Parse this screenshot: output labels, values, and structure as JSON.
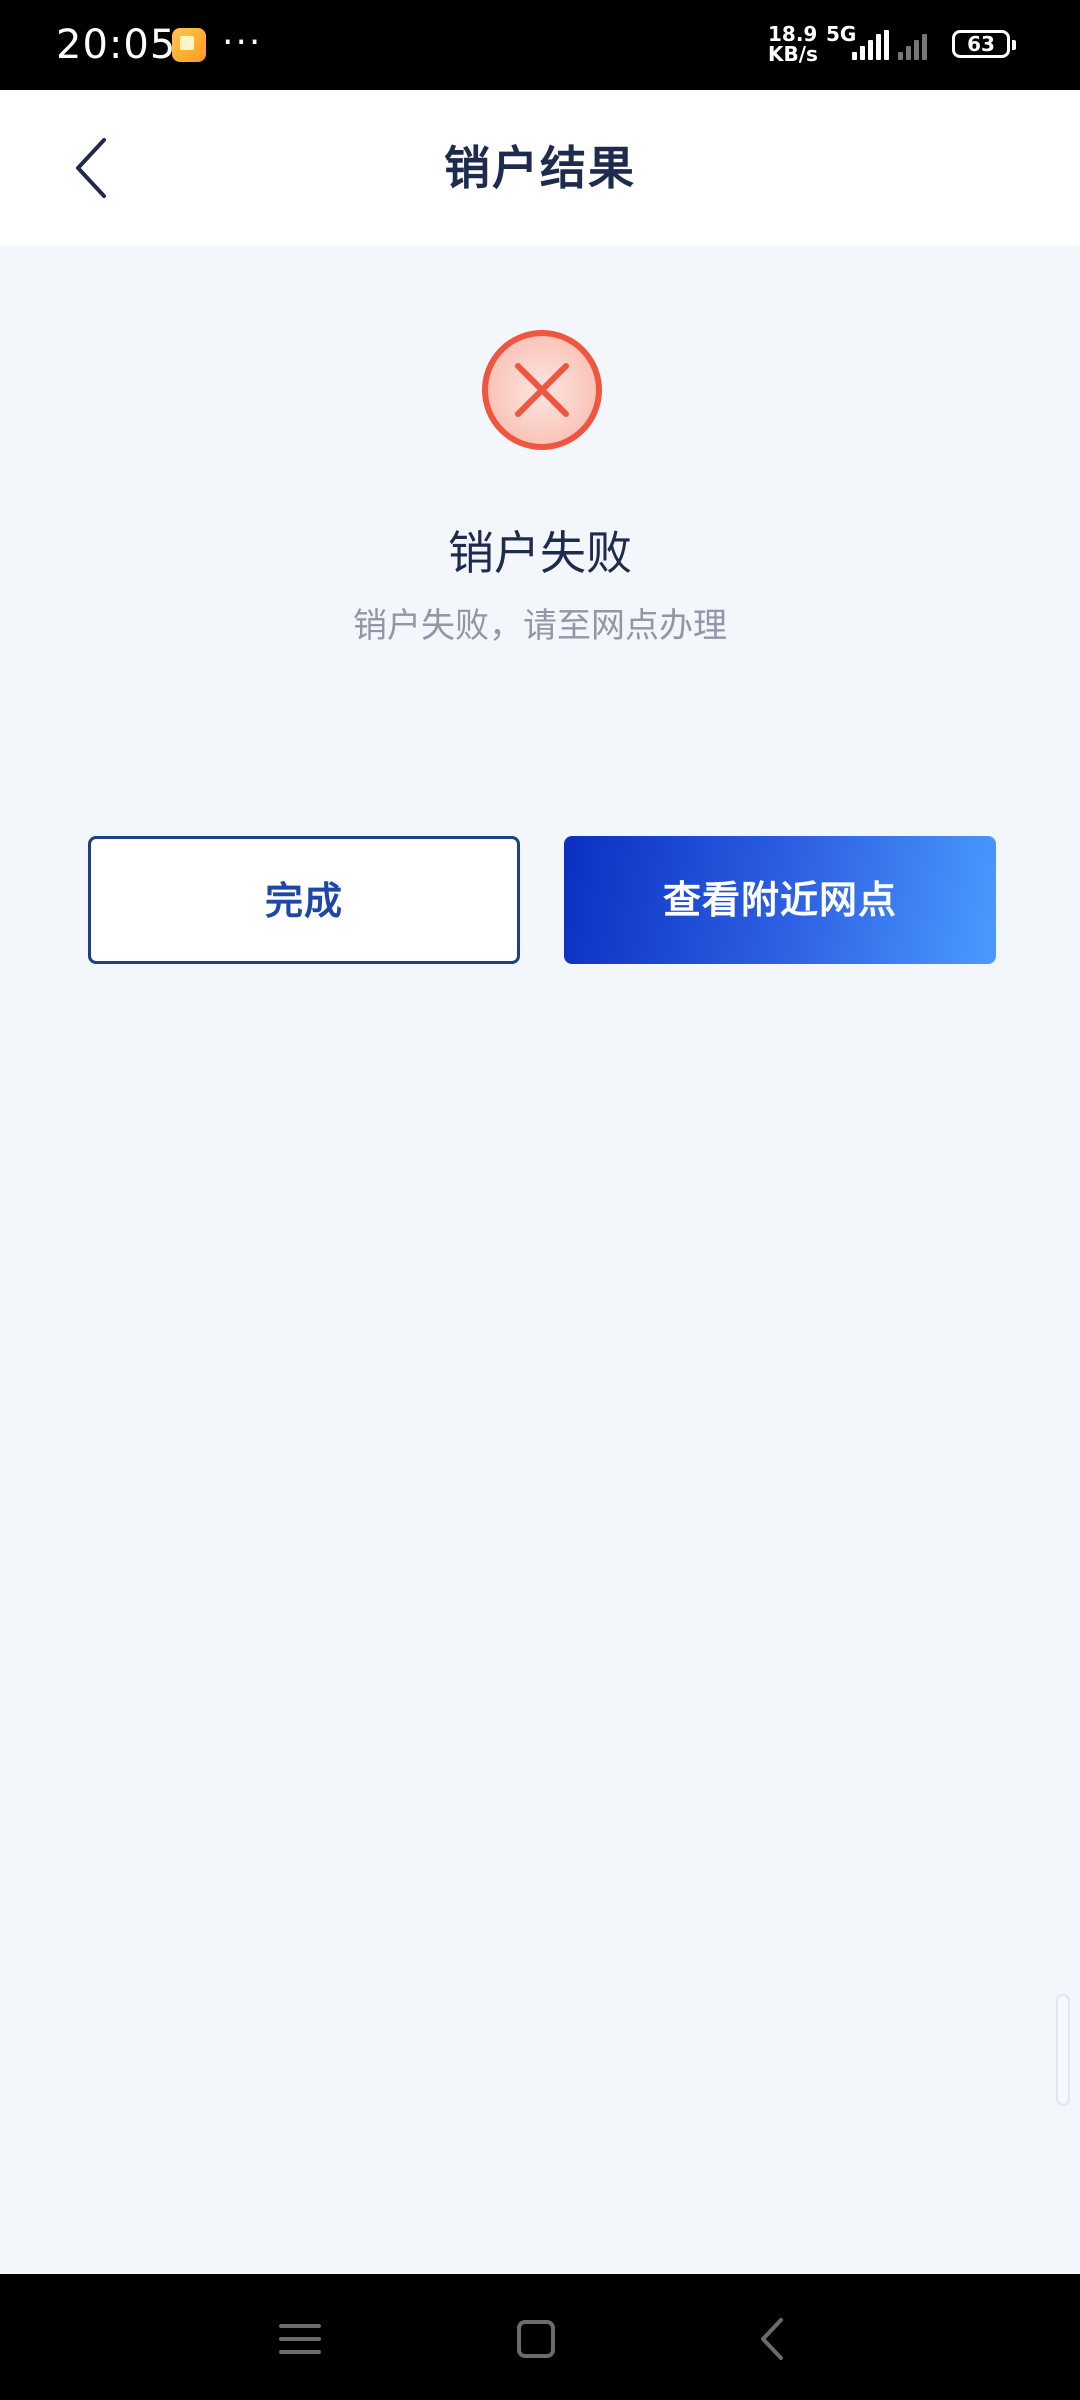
{
  "status_bar": {
    "time": "20:05",
    "dots": "···",
    "speed_value": "18.9",
    "speed_unit": "KB/s",
    "network": "5G",
    "battery": "63"
  },
  "header": {
    "title": "销户结果",
    "back_icon": "chevron-left-icon"
  },
  "result": {
    "icon": "error-circle-icon",
    "icon_color": "#f0553f",
    "title": "销户失败",
    "message": "销户失败，请至网点办理"
  },
  "actions": {
    "done_label": "完成",
    "nearby_label": "查看附近网点"
  },
  "colors": {
    "background": "#f3f6fb",
    "primary": "#1e48a8",
    "error": "#f0553f"
  }
}
